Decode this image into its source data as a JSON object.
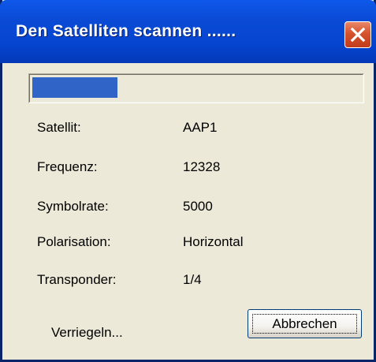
{
  "window": {
    "title": "Den Satelliten scannen ......"
  },
  "progress": {
    "fraction": 0.26,
    "color": "#3164c7"
  },
  "rows": [
    {
      "label": "Satellit:",
      "value": "AAP1"
    },
    {
      "label": "Frequenz:",
      "value": "12328"
    },
    {
      "label": "Symbolrate:",
      "value": "5000"
    },
    {
      "label": "Polarisation:",
      "value": "Horizontal"
    },
    {
      "label": "Transponder:",
      "value": "1/4"
    }
  ],
  "footer": {
    "lock_label": "Verriegeln...",
    "cancel_label": "Abbrechen"
  },
  "colors": {
    "titlebar": "#0545d0",
    "close": "#d6522c",
    "dialog_bg": "#ece9d8"
  }
}
